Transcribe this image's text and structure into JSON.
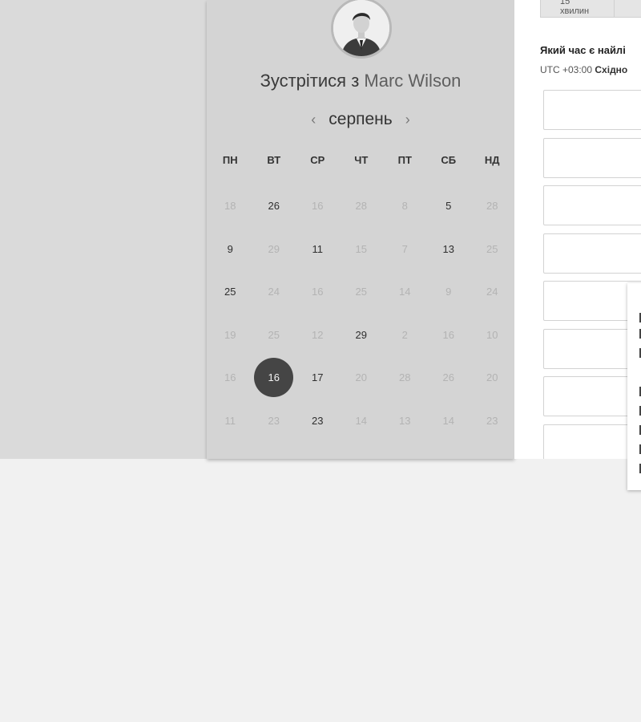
{
  "host": {
    "title_prefix": "Зустрітися з",
    "name": "Marc Wilson"
  },
  "calendar": {
    "month": "серпень",
    "prev_icon": "chevron-left-icon",
    "next_icon": "chevron-right-icon",
    "weekdays": [
      "ПН",
      "ВТ",
      "СР",
      "ЧТ",
      "ПТ",
      "СБ",
      "НД"
    ],
    "weeks": [
      [
        {
          "d": "18",
          "a": false
        },
        {
          "d": "26",
          "a": true
        },
        {
          "d": "16",
          "a": false
        },
        {
          "d": "28",
          "a": false
        },
        {
          "d": "8",
          "a": false
        },
        {
          "d": "5",
          "a": true
        },
        {
          "d": "28",
          "a": false
        }
      ],
      [
        {
          "d": "9",
          "a": true
        },
        {
          "d": "29",
          "a": false
        },
        {
          "d": "11",
          "a": true
        },
        {
          "d": "15",
          "a": false
        },
        {
          "d": "7",
          "a": false
        },
        {
          "d": "13",
          "a": true
        },
        {
          "d": "25",
          "a": false
        }
      ],
      [
        {
          "d": "25",
          "a": true
        },
        {
          "d": "24",
          "a": false
        },
        {
          "d": "16",
          "a": false
        },
        {
          "d": "25",
          "a": false
        },
        {
          "d": "14",
          "a": false
        },
        {
          "d": "9",
          "a": false
        },
        {
          "d": "24",
          "a": false
        }
      ],
      [
        {
          "d": "19",
          "a": false
        },
        {
          "d": "25",
          "a": false
        },
        {
          "d": "12",
          "a": false
        },
        {
          "d": "29",
          "a": true
        },
        {
          "d": "2",
          "a": false
        },
        {
          "d": "16",
          "a": false
        },
        {
          "d": "10",
          "a": false
        }
      ],
      [
        {
          "d": "16",
          "a": false
        },
        {
          "d": "16",
          "a": true,
          "sel": true
        },
        {
          "d": "17",
          "a": true
        },
        {
          "d": "20",
          "a": false
        },
        {
          "d": "28",
          "a": false
        },
        {
          "d": "26",
          "a": false
        },
        {
          "d": "20",
          "a": false
        }
      ],
      [
        {
          "d": "11",
          "a": false
        },
        {
          "d": "23",
          "a": false
        },
        {
          "d": "23",
          "a": true
        },
        {
          "d": "14",
          "a": false
        },
        {
          "d": "13",
          "a": false
        },
        {
          "d": "14",
          "a": false
        },
        {
          "d": "23",
          "a": false
        }
      ]
    ]
  },
  "booking": {
    "durations": [
      "15 хвилин",
      ""
    ],
    "question": "Який час є найлі",
    "tz_offset": "UTC +03:00",
    "tz_name": "Східно",
    "slot_count": 8
  },
  "colors": {
    "selected_day": "#454545",
    "panel_bg": "#d4d4d4"
  }
}
